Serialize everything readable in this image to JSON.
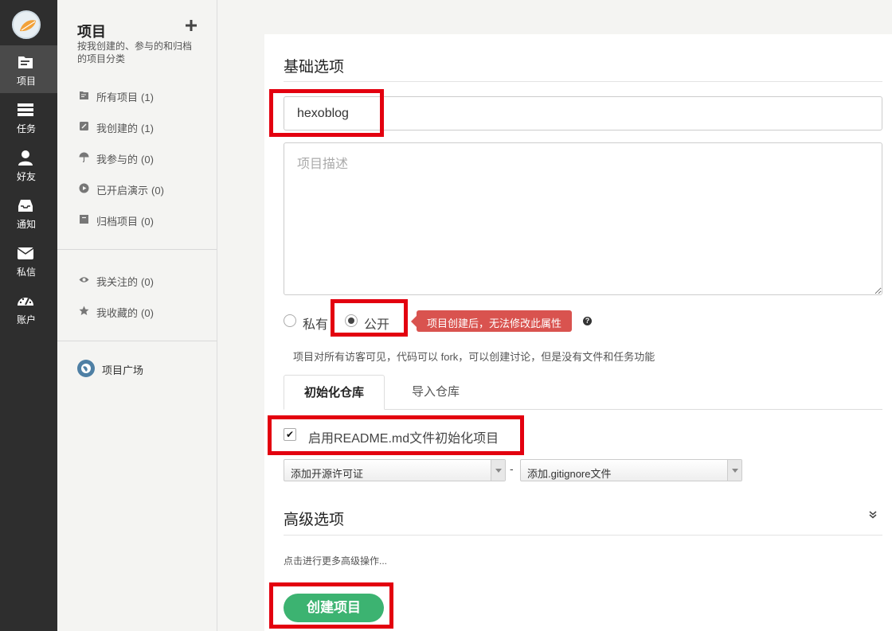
{
  "nav": {
    "items": [
      {
        "label": "项目",
        "icon": "folder-icon"
      },
      {
        "label": "任务",
        "icon": "tasks-icon"
      },
      {
        "label": "好友",
        "icon": "user-icon"
      },
      {
        "label": "通知",
        "icon": "inbox-icon"
      },
      {
        "label": "私信",
        "icon": "envelope-icon"
      },
      {
        "label": "账户",
        "icon": "dashboard-icon"
      }
    ]
  },
  "sidebar": {
    "title": "项目",
    "description": "按我创建的、参与的和归档的项目分类",
    "items": [
      {
        "label": "所有项目",
        "count": "(1)",
        "icon": "folder-icon"
      },
      {
        "label": "我创建的",
        "count": "(1)",
        "icon": "edit-icon"
      },
      {
        "label": "我参与的",
        "count": "(0)",
        "icon": "umbrella-icon"
      },
      {
        "label": "已开启演示",
        "count": "(0)",
        "icon": "play-icon"
      },
      {
        "label": "归档项目",
        "count": "(0)",
        "icon": "archive-icon"
      }
    ],
    "items2": [
      {
        "label": "我关注的",
        "count": "(0)",
        "icon": "eye-icon"
      },
      {
        "label": "我收藏的",
        "count": "(0)",
        "icon": "star-icon"
      }
    ],
    "plaza": "项目广场"
  },
  "form": {
    "basic_title": "基础选项",
    "name_value": "hexoblog",
    "desc_placeholder": "项目描述",
    "private_label": "私有",
    "public_label": "公开",
    "tooltip": "项目创建后，无法修改此属性",
    "help": "?",
    "visibility_note": "项目对所有访客可见，代码可以 fork，可以创建讨论，但是没有文件和任务功能",
    "tab_init": "初始化仓库",
    "tab_import": "导入仓库",
    "readme_label": "启用README.md文件初始化项目",
    "license_select": "添加开源许可证",
    "separator": "-",
    "gitignore_select": "添加.gitignore文件",
    "advanced_title": "高级选项",
    "advanced_note": "点击进行更多高级操作...",
    "create_button": "创建项目"
  },
  "colors": {
    "nav_bg": "#2e2e2e",
    "accent_green": "#3cb371",
    "tooltip_red": "#d9534f",
    "highlight_red": "#e3000f"
  }
}
